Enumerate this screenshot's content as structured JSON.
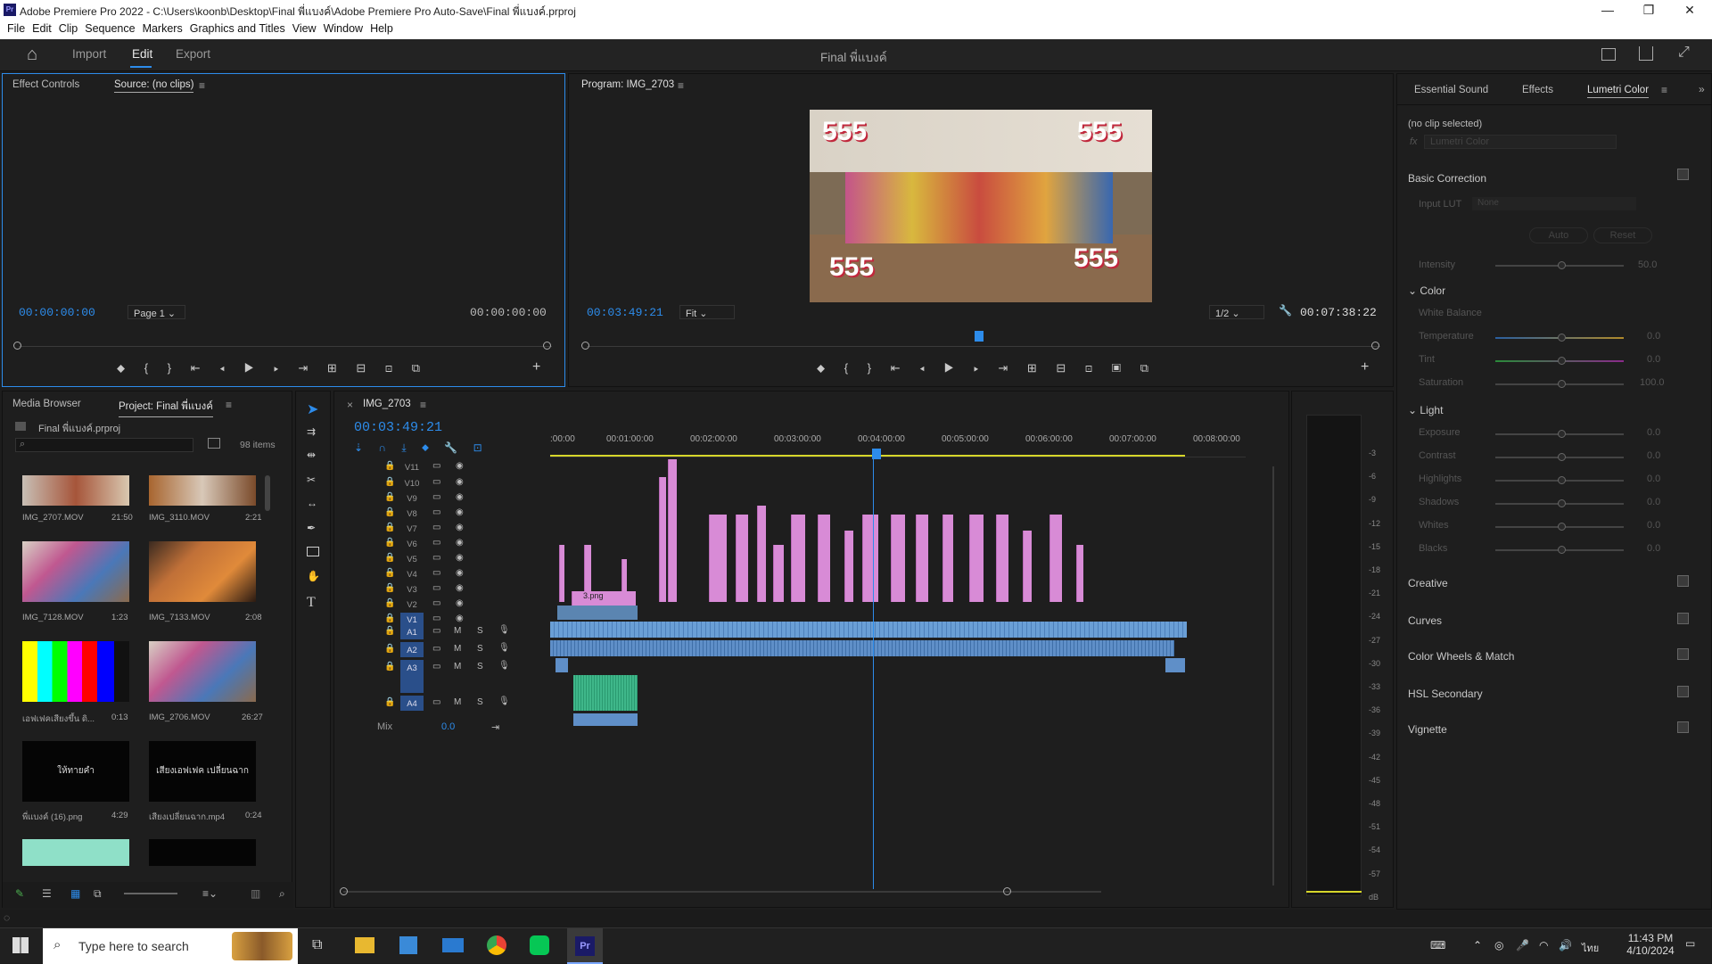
{
  "window": {
    "title": "Adobe Premiere Pro 2022 - C:\\Users\\koonb\\Desktop\\Final พี่แบงค์\\Adobe Premiere Pro Auto-Save\\Final พี่แบงค์.prproj",
    "min": "—",
    "max": "❐",
    "close": "✕"
  },
  "menu": [
    "File",
    "Edit",
    "Clip",
    "Sequence",
    "Markers",
    "Graphics and Titles",
    "View",
    "Window",
    "Help"
  ],
  "header": {
    "home": "⌂",
    "import": "Import",
    "edit": "Edit",
    "export": "Export",
    "project_title": "Final พี่แบงค์"
  },
  "source": {
    "tab1": "Effect Controls",
    "tab2": "Source: (no clips)",
    "timecode_in": "00:00:00:00",
    "page": "Page 1",
    "timecode_out": "00:00:00:00"
  },
  "program": {
    "tab": "Program: IMG_2703",
    "timecode": "00:03:49:21",
    "fit": "Fit",
    "res": "1/2",
    "duration": "00:07:38:22",
    "playhead_frac": 0.495
  },
  "right_tabs": {
    "essential": "Essential Sound",
    "effects": "Effects",
    "lumetri": "Lumetri Color"
  },
  "lumetri": {
    "no_clip": "(no clip selected)",
    "fx_label": "Lumetri Color",
    "basic": "Basic Correction",
    "input_lut": "Input LUT",
    "lut_val": "None",
    "auto": "Auto",
    "reset": "Reset",
    "intensity": "Intensity",
    "intensity_val": "50.0",
    "color": "Color",
    "white_balance": "White Balance",
    "temperature": "Temperature",
    "tint": "Tint",
    "saturation": "Saturation",
    "sat_val": "100.0",
    "zero": "0.0",
    "light": "Light",
    "exposure": "Exposure",
    "contrast": "Contrast",
    "highlights": "Highlights",
    "shadows": "Shadows",
    "whites": "Whites",
    "blacks": "Blacks",
    "creative": "Creative",
    "curves": "Curves",
    "wheels": "Color Wheels & Match",
    "hsl": "HSL Secondary",
    "vignette": "Vignette"
  },
  "project": {
    "tab1": "Media Browser",
    "tab2": "Project: Final พี่แบงค์",
    "file": "Final พี่แบงค์.prproj",
    "items": "98 items",
    "thumbs": [
      {
        "name": "IMG_2707.MOV",
        "dur": "21:50"
      },
      {
        "name": "IMG_3110.MOV",
        "dur": "2:21"
      },
      {
        "name": "IMG_7128.MOV",
        "dur": "1:23"
      },
      {
        "name": "IMG_7133.MOV",
        "dur": "2:08"
      },
      {
        "name": "เอฟเฟคเสียงขึ้น ดิ...",
        "dur": "0:13"
      },
      {
        "name": "IMG_2706.MOV",
        "dur": "26:27"
      },
      {
        "name": "พี่แบงค์ (16).png",
        "dur": "4:29"
      },
      {
        "name": "เสียงเปลี่ยนฉาก.mp4",
        "dur": "0:24"
      }
    ],
    "thumb_text1": "ให้ทายคำ",
    "thumb_text2": "เสียงเอฟเฟค เปลี่ยนฉาก"
  },
  "timeline": {
    "tab": "IMG_2703",
    "timecode": "00:03:49:21",
    "ruler": [
      ":00:00",
      "00:01:00:00",
      "00:02:00:00",
      "00:03:00:00",
      "00:04:00:00",
      "00:05:00:00",
      "00:06:00:00",
      "00:07:00:00",
      "00:08:00:00"
    ],
    "video_tracks": [
      "V11",
      "V10",
      "V9",
      "V8",
      "V7",
      "V6",
      "V5",
      "V4",
      "V3",
      "V2",
      "V1"
    ],
    "audio_tracks": [
      "A1",
      "A2",
      "A3",
      "A4"
    ],
    "mix": "Mix",
    "mix_val": "0.0",
    "m": "M",
    "s": "S",
    "clip_label": "3.png"
  },
  "meter": [
    "-3",
    "-6",
    "-9",
    "-12",
    "-15",
    "-18",
    "-21",
    "-24",
    "-27",
    "-30",
    "-33",
    "-36",
    "-39",
    "-42",
    "-45",
    "-48",
    "-51",
    "-54",
    "-57",
    "dB"
  ],
  "taskbar": {
    "search": "Type here to search",
    "time": "11:43 PM",
    "date": "4/10/2024",
    "lang": "ไทย"
  },
  "colors": {
    "accent": "#2d8ceb",
    "video_clip": "#d88bd6",
    "v1_clip": "#6a9fd6",
    "audio_clip": "#5f8fc8",
    "green_clip": "#3fb78a"
  }
}
